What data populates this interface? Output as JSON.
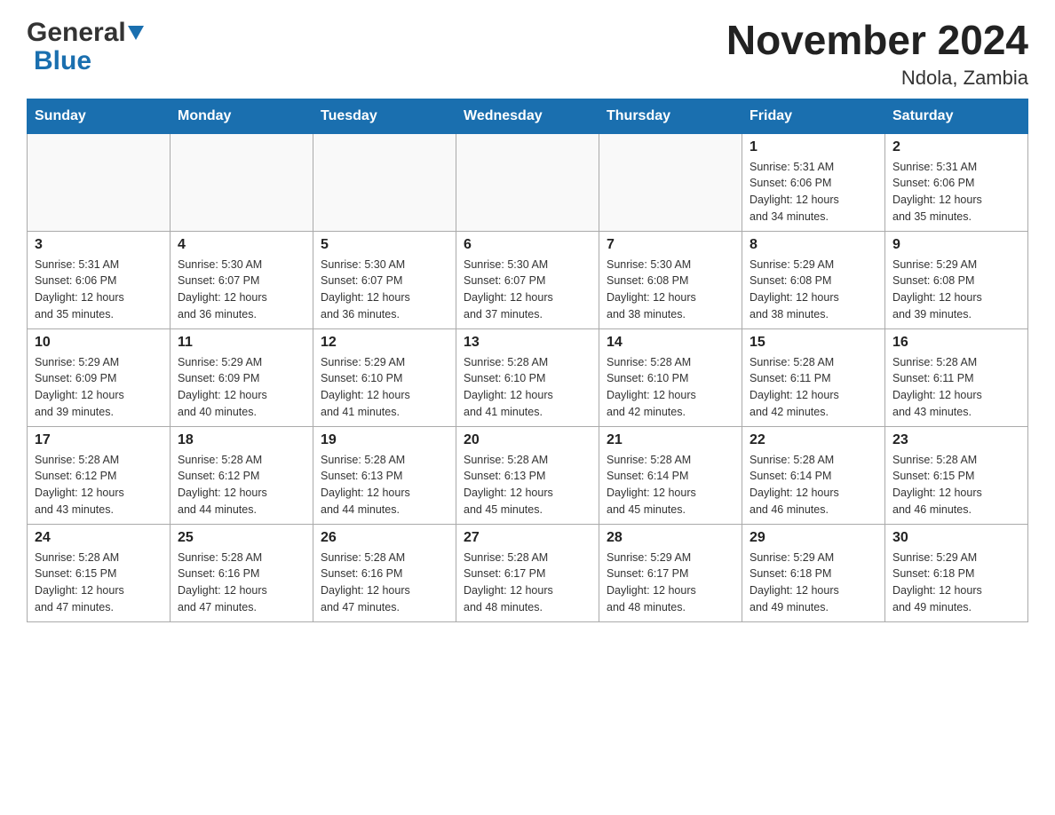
{
  "logo": {
    "text_general": "General",
    "text_blue": "Blue"
  },
  "header": {
    "month_year": "November 2024",
    "location": "Ndola, Zambia"
  },
  "weekdays": [
    "Sunday",
    "Monday",
    "Tuesday",
    "Wednesday",
    "Thursday",
    "Friday",
    "Saturday"
  ],
  "weeks": [
    {
      "days": [
        {
          "number": "",
          "info": ""
        },
        {
          "number": "",
          "info": ""
        },
        {
          "number": "",
          "info": ""
        },
        {
          "number": "",
          "info": ""
        },
        {
          "number": "",
          "info": ""
        },
        {
          "number": "1",
          "info": "Sunrise: 5:31 AM\nSunset: 6:06 PM\nDaylight: 12 hours\nand 34 minutes."
        },
        {
          "number": "2",
          "info": "Sunrise: 5:31 AM\nSunset: 6:06 PM\nDaylight: 12 hours\nand 35 minutes."
        }
      ]
    },
    {
      "days": [
        {
          "number": "3",
          "info": "Sunrise: 5:31 AM\nSunset: 6:06 PM\nDaylight: 12 hours\nand 35 minutes."
        },
        {
          "number": "4",
          "info": "Sunrise: 5:30 AM\nSunset: 6:07 PM\nDaylight: 12 hours\nand 36 minutes."
        },
        {
          "number": "5",
          "info": "Sunrise: 5:30 AM\nSunset: 6:07 PM\nDaylight: 12 hours\nand 36 minutes."
        },
        {
          "number": "6",
          "info": "Sunrise: 5:30 AM\nSunset: 6:07 PM\nDaylight: 12 hours\nand 37 minutes."
        },
        {
          "number": "7",
          "info": "Sunrise: 5:30 AM\nSunset: 6:08 PM\nDaylight: 12 hours\nand 38 minutes."
        },
        {
          "number": "8",
          "info": "Sunrise: 5:29 AM\nSunset: 6:08 PM\nDaylight: 12 hours\nand 38 minutes."
        },
        {
          "number": "9",
          "info": "Sunrise: 5:29 AM\nSunset: 6:08 PM\nDaylight: 12 hours\nand 39 minutes."
        }
      ]
    },
    {
      "days": [
        {
          "number": "10",
          "info": "Sunrise: 5:29 AM\nSunset: 6:09 PM\nDaylight: 12 hours\nand 39 minutes."
        },
        {
          "number": "11",
          "info": "Sunrise: 5:29 AM\nSunset: 6:09 PM\nDaylight: 12 hours\nand 40 minutes."
        },
        {
          "number": "12",
          "info": "Sunrise: 5:29 AM\nSunset: 6:10 PM\nDaylight: 12 hours\nand 41 minutes."
        },
        {
          "number": "13",
          "info": "Sunrise: 5:28 AM\nSunset: 6:10 PM\nDaylight: 12 hours\nand 41 minutes."
        },
        {
          "number": "14",
          "info": "Sunrise: 5:28 AM\nSunset: 6:10 PM\nDaylight: 12 hours\nand 42 minutes."
        },
        {
          "number": "15",
          "info": "Sunrise: 5:28 AM\nSunset: 6:11 PM\nDaylight: 12 hours\nand 42 minutes."
        },
        {
          "number": "16",
          "info": "Sunrise: 5:28 AM\nSunset: 6:11 PM\nDaylight: 12 hours\nand 43 minutes."
        }
      ]
    },
    {
      "days": [
        {
          "number": "17",
          "info": "Sunrise: 5:28 AM\nSunset: 6:12 PM\nDaylight: 12 hours\nand 43 minutes."
        },
        {
          "number": "18",
          "info": "Sunrise: 5:28 AM\nSunset: 6:12 PM\nDaylight: 12 hours\nand 44 minutes."
        },
        {
          "number": "19",
          "info": "Sunrise: 5:28 AM\nSunset: 6:13 PM\nDaylight: 12 hours\nand 44 minutes."
        },
        {
          "number": "20",
          "info": "Sunrise: 5:28 AM\nSunset: 6:13 PM\nDaylight: 12 hours\nand 45 minutes."
        },
        {
          "number": "21",
          "info": "Sunrise: 5:28 AM\nSunset: 6:14 PM\nDaylight: 12 hours\nand 45 minutes."
        },
        {
          "number": "22",
          "info": "Sunrise: 5:28 AM\nSunset: 6:14 PM\nDaylight: 12 hours\nand 46 minutes."
        },
        {
          "number": "23",
          "info": "Sunrise: 5:28 AM\nSunset: 6:15 PM\nDaylight: 12 hours\nand 46 minutes."
        }
      ]
    },
    {
      "days": [
        {
          "number": "24",
          "info": "Sunrise: 5:28 AM\nSunset: 6:15 PM\nDaylight: 12 hours\nand 47 minutes."
        },
        {
          "number": "25",
          "info": "Sunrise: 5:28 AM\nSunset: 6:16 PM\nDaylight: 12 hours\nand 47 minutes."
        },
        {
          "number": "26",
          "info": "Sunrise: 5:28 AM\nSunset: 6:16 PM\nDaylight: 12 hours\nand 47 minutes."
        },
        {
          "number": "27",
          "info": "Sunrise: 5:28 AM\nSunset: 6:17 PM\nDaylight: 12 hours\nand 48 minutes."
        },
        {
          "number": "28",
          "info": "Sunrise: 5:29 AM\nSunset: 6:17 PM\nDaylight: 12 hours\nand 48 minutes."
        },
        {
          "number": "29",
          "info": "Sunrise: 5:29 AM\nSunset: 6:18 PM\nDaylight: 12 hours\nand 49 minutes."
        },
        {
          "number": "30",
          "info": "Sunrise: 5:29 AM\nSunset: 6:18 PM\nDaylight: 12 hours\nand 49 minutes."
        }
      ]
    }
  ]
}
